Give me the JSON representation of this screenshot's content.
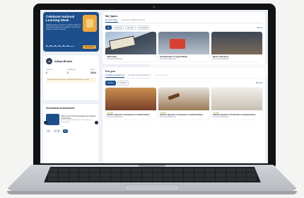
{
  "banner": {
    "title": "Celebrate National Learning Week",
    "body": "Digital learning continues to redefine efficiency, expanding students can engage in learning at anytime of school learning.",
    "cta_label": "Know More"
  },
  "profile": {
    "avatar_initials": "AB",
    "name": "Aditya Bhasin",
    "stats": [
      {
        "label": "Courses",
        "value": "2"
      },
      {
        "label": "Certificates",
        "value": "2"
      },
      {
        "label": "Score",
        "value": "18.64"
      }
    ],
    "note": "NCCE Module requirements CERTIFICATION due Dec 2024"
  },
  "schedule": {
    "title": "Scheduled Assessment",
    "item_title": "Mid Level Of Training Programme Practice Assessment",
    "item_sub": "Assessment Fundamentals Of Teaching and Management",
    "date_label": "15",
    "time_label": "10 : 40",
    "go_label": "Go"
  },
  "myspace": {
    "title": "My Space",
    "tabs": [
      "My iGOT Plans",
      "Competency Based Learning"
    ],
    "chips": [
      "All",
      "Ongoing",
      "Overdue",
      "Completed"
    ],
    "view_all": "View all",
    "cards": [
      {
        "title": "Citizenship",
        "meta": "By Karmayogi Bharat"
      },
      {
        "title": "Fundamentals of Legal Drafting",
        "meta": "By Karmayogi Bharat"
      },
      {
        "title": "Basic of Business",
        "meta": "By Karmayogi Bharat"
      }
    ]
  },
  "foryou": {
    "title": "For you",
    "tabs": [
      "Trending in Department",
      "Trending across Department",
      "Recently Added"
    ],
    "chips": [
      "Courses",
      "Programs"
    ],
    "view_all": "Show all",
    "cards": [
      {
        "badge": "Course",
        "title": "Practice Question: Introduction to Administrative",
        "meta": "By Karmayogi Bharat"
      },
      {
        "badge": "Course",
        "title": "Practice Question: Introduction to Administrative",
        "meta": "By Karmayogi Bharat"
      },
      {
        "badge": "Course",
        "title": "Practice Question: Introduction to Administrative",
        "meta": "By Karmayogi Bharat"
      }
    ]
  },
  "colors": {
    "brand": "#1c4f8c",
    "accent": "#f0a83a"
  }
}
